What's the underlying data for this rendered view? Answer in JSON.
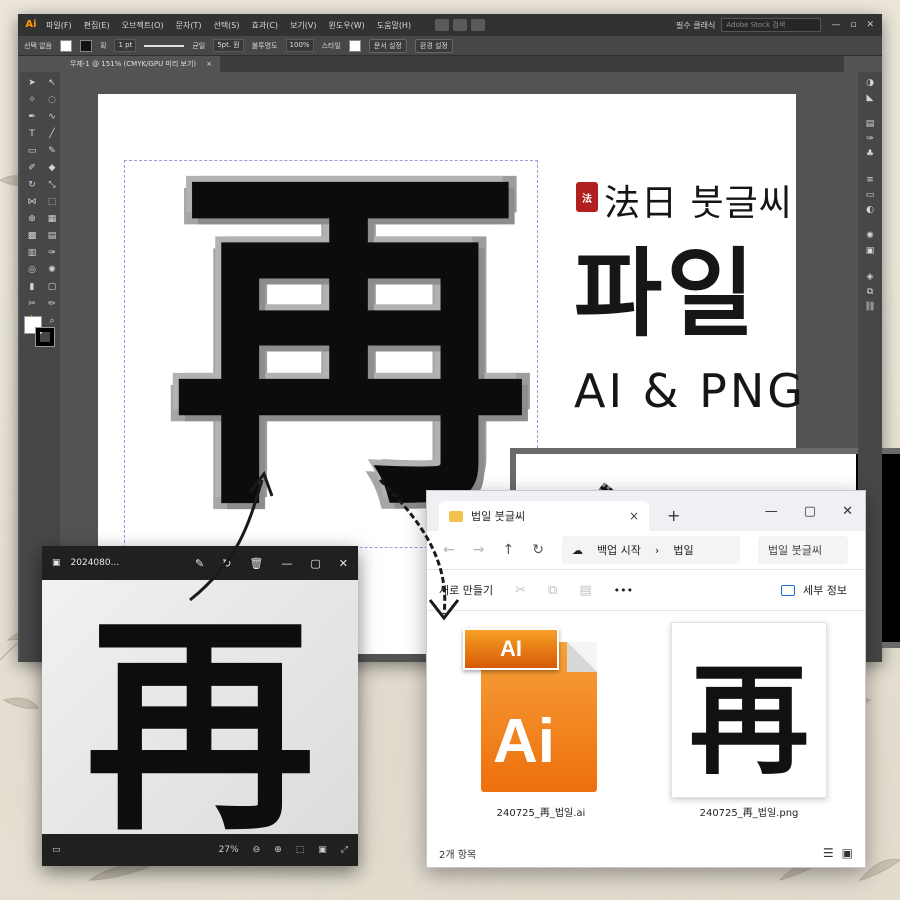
{
  "illustrator": {
    "logo": "Ai",
    "menus": [
      "파일(F)",
      "편집(E)",
      "오브젝트(O)",
      "문자(T)",
      "선택(S)",
      "효과(C)",
      "보기(V)",
      "윈도우(W)",
      "도움말(H)"
    ],
    "workspace": "필수 클래식",
    "search_placeholder": "Adobe Stock 검색",
    "control": {
      "selection_label": "선택 없음",
      "stroke_label": "획",
      "stroke_weight": "1 pt",
      "stroke_style": "균일",
      "brush_label": "5pt. 원",
      "opacity_label": "불투명도",
      "opacity_value": "100%",
      "style_label": "스타일",
      "doc_setup": "문서 설정",
      "prefs": "환경 설정"
    },
    "doc_tab": "무제-1 @ 151% (CMYK/GPU 미리 보기)",
    "doc_tab_close": "×",
    "big_char": "再",
    "brand_seal": "法",
    "brand_name": "法日 붓글씨",
    "title_main": "파일",
    "title_sub": "AI & PNG"
  },
  "photo_viewer": {
    "title": "2024080...",
    "photo_char": "再",
    "zoom": "27%"
  },
  "explorer": {
    "tab_title": "법일 붓글씨",
    "tab_close": "×",
    "new_tab": "+",
    "breadcrumb": [
      "백업 시작",
      "법일"
    ],
    "search_placeholder": "법일 붓글씨",
    "new_button": "새로 만들기",
    "more": "•••",
    "details": "세부 정보",
    "files": [
      {
        "name": "240725_再_법일.ai",
        "badge": "AI",
        "icon_text": "Ai"
      },
      {
        "name": "240725_再_법일.png",
        "thumb_char": "再"
      }
    ],
    "status": "2개 항목"
  },
  "colors": {
    "ai_orange": "#ed6f0d",
    "seal_red": "#b11f1f",
    "canvas_gray": "#535353"
  }
}
